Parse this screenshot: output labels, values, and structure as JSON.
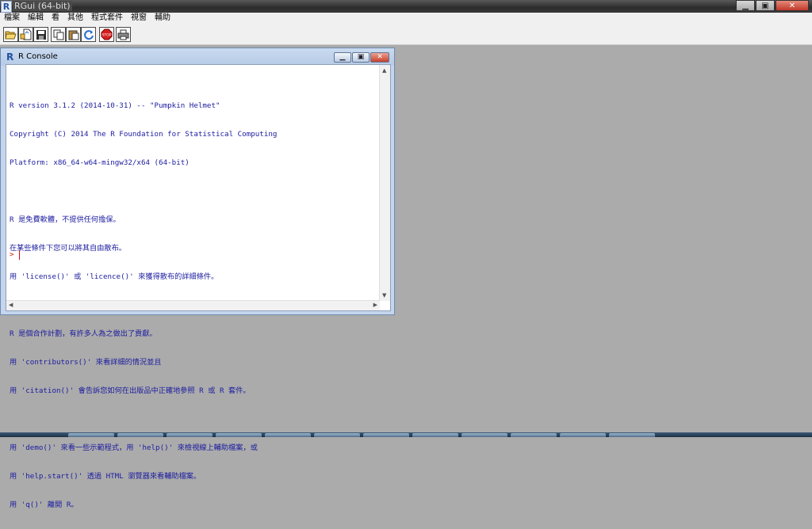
{
  "app": {
    "title": "RGui (64-bit)",
    "icon": "R",
    "window_buttons": {
      "minimize": "▁",
      "restore": "▣",
      "close": "✕"
    }
  },
  "menu": [
    "檔案",
    "編輯",
    "看",
    "其他",
    "程式套件",
    "視窗",
    "輔助"
  ],
  "toolbar": [
    {
      "name": "open-script-icon",
      "glyph": "📂"
    },
    {
      "name": "load-workspace-icon",
      "glyph": "📄"
    },
    {
      "name": "save-workspace-icon",
      "glyph": "💾"
    },
    {
      "name": "copy-icon",
      "glyph": "⎘"
    },
    {
      "name": "paste-icon",
      "glyph": "📋"
    },
    {
      "name": "copy-paste-icon",
      "glyph": "⟳"
    },
    {
      "name": "stop-icon",
      "glyph": "STOP"
    },
    {
      "name": "print-icon",
      "glyph": "🖶"
    }
  ],
  "console": {
    "title": "R Console",
    "icon": "R",
    "buttons": {
      "minimize": "▁",
      "restore": "▣",
      "close": "✕"
    },
    "lines": [
      "R version 3.1.2 (2014-10-31) -- \"Pumpkin Helmet\"",
      "Copyright (C) 2014 The R Foundation for Statistical Computing",
      "Platform: x86_64-w64-mingw32/x64 (64-bit)",
      "",
      "R 是免費軟體，不提供任何擔保。",
      "在某些條件下您可以將其自由散布。",
      "用 'license()' 或 'licence()' 來獲得散布的詳細條件。",
      "",
      "R 是個合作計劃，有許多人為之做出了貢獻。",
      "用 'contributors()' 來看詳細的情況並且",
      "用 'citation()' 會告訴您如何在出版品中正確地參照 R 或 R 套件。",
      "",
      "用 'demo()' 來看一些示範程式，用 'help()' 來檢視線上輔助檔案，或",
      "用 'help.start()' 透過 HTML 瀏覽器來看輔助檔案。",
      "用 'q()' 離開 R。"
    ],
    "prompt": ">"
  },
  "colors": {
    "console_text": "#1c1ca0",
    "prompt": "#d01010",
    "desktop": "#ababab"
  }
}
